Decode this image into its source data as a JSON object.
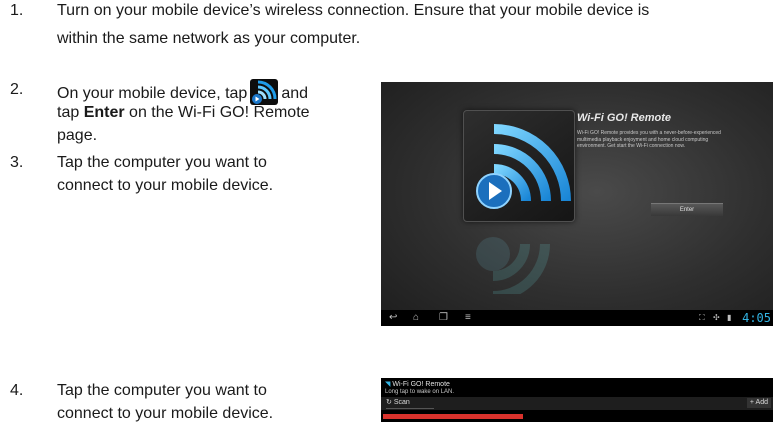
{
  "steps": {
    "s1": {
      "num": "1.",
      "line1": "Turn on your mobile device’s wireless connection. Ensure that your mobile device is",
      "line2": "within the same network as your computer."
    },
    "s2": {
      "num": "2.",
      "pre": "On your mobile device, tap",
      "post": "and",
      "l2_pre": "tap ",
      "l2_bold": "Enter",
      "l2_post": " on the Wi-Fi GO! Remote",
      "line3": "page."
    },
    "s3": {
      "num": "3.",
      "line1": "Tap the computer you want to",
      "line2": "connect to your mobile device."
    },
    "s4": {
      "num": "4.",
      "line1": "Tap the computer you want to",
      "line2": "connect to your mobile device."
    }
  },
  "screen1": {
    "app_title": "Wi-Fi GO! Remote",
    "description": "Wi-Fi GO! Remote provides you with a never-before-experienced multimedia playback enjoyment and home cloud computing environment. Get start the Wi-Fi connection now.",
    "enter_label": "Enter",
    "clock": "4:05",
    "nav_icons": [
      "back-icon",
      "home-icon",
      "recent-apps-icon",
      "menu-icon"
    ],
    "status_icons": [
      "fullscreen-icon",
      "usb-icon",
      "battery-icon"
    ],
    "accent": "#33b5e5"
  },
  "screen2": {
    "title": "Wi-Fi GO! Remote",
    "subtitle": "Long tap to wake on LAN.",
    "scan_label": "Scan",
    "add_label": "Add",
    "highlight_color": "#d9322c"
  }
}
